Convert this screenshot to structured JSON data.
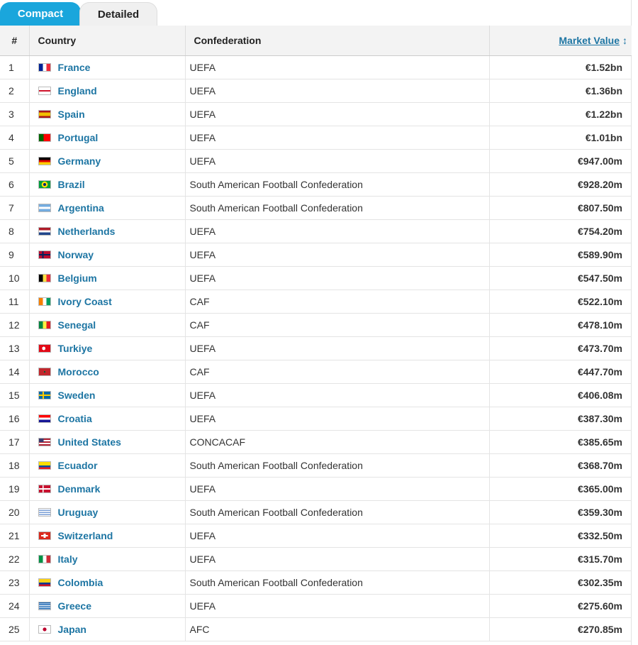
{
  "tabs": [
    {
      "label": "Compact",
      "active": true
    },
    {
      "label": "Detailed",
      "active": false
    }
  ],
  "table": {
    "headers": {
      "rank": "#",
      "country": "Country",
      "confederation": "Confederation",
      "value": "Market Value",
      "sort_icon": "↕"
    },
    "rows": [
      {
        "rank": "1",
        "country": "France",
        "confederation": "UEFA",
        "value": "€1.52bn",
        "flag": "france"
      },
      {
        "rank": "2",
        "country": "England",
        "confederation": "UEFA",
        "value": "€1.36bn",
        "flag": "england"
      },
      {
        "rank": "3",
        "country": "Spain",
        "confederation": "UEFA",
        "value": "€1.22bn",
        "flag": "spain"
      },
      {
        "rank": "4",
        "country": "Portugal",
        "confederation": "UEFA",
        "value": "€1.01bn",
        "flag": "portugal"
      },
      {
        "rank": "5",
        "country": "Germany",
        "confederation": "UEFA",
        "value": "€947.00m",
        "flag": "germany"
      },
      {
        "rank": "6",
        "country": "Brazil",
        "confederation": "South American Football Confederation",
        "value": "€928.20m",
        "flag": "brazil"
      },
      {
        "rank": "7",
        "country": "Argentina",
        "confederation": "South American Football Confederation",
        "value": "€807.50m",
        "flag": "argentina"
      },
      {
        "rank": "8",
        "country": "Netherlands",
        "confederation": "UEFA",
        "value": "€754.20m",
        "flag": "netherlands"
      },
      {
        "rank": "9",
        "country": "Norway",
        "confederation": "UEFA",
        "value": "€589.90m",
        "flag": "norway"
      },
      {
        "rank": "10",
        "country": "Belgium",
        "confederation": "UEFA",
        "value": "€547.50m",
        "flag": "belgium"
      },
      {
        "rank": "11",
        "country": "Ivory Coast",
        "confederation": "CAF",
        "value": "€522.10m",
        "flag": "ivory-coast"
      },
      {
        "rank": "12",
        "country": "Senegal",
        "confederation": "CAF",
        "value": "€478.10m",
        "flag": "senegal"
      },
      {
        "rank": "13",
        "country": "Turkiye",
        "confederation": "UEFA",
        "value": "€473.70m",
        "flag": "turkiye"
      },
      {
        "rank": "14",
        "country": "Morocco",
        "confederation": "CAF",
        "value": "€447.70m",
        "flag": "morocco"
      },
      {
        "rank": "15",
        "country": "Sweden",
        "confederation": "UEFA",
        "value": "€406.08m",
        "flag": "sweden"
      },
      {
        "rank": "16",
        "country": "Croatia",
        "confederation": "UEFA",
        "value": "€387.30m",
        "flag": "croatia"
      },
      {
        "rank": "17",
        "country": "United States",
        "confederation": "CONCACAF",
        "value": "€385.65m",
        "flag": "united-states"
      },
      {
        "rank": "18",
        "country": "Ecuador",
        "confederation": "South American Football Confederation",
        "value": "€368.70m",
        "flag": "ecuador"
      },
      {
        "rank": "19",
        "country": "Denmark",
        "confederation": "UEFA",
        "value": "€365.00m",
        "flag": "denmark"
      },
      {
        "rank": "20",
        "country": "Uruguay",
        "confederation": "South American Football Confederation",
        "value": "€359.30m",
        "flag": "uruguay"
      },
      {
        "rank": "21",
        "country": "Switzerland",
        "confederation": "UEFA",
        "value": "€332.50m",
        "flag": "switzerland"
      },
      {
        "rank": "22",
        "country": "Italy",
        "confederation": "UEFA",
        "value": "€315.70m",
        "flag": "italy"
      },
      {
        "rank": "23",
        "country": "Colombia",
        "confederation": "South American Football Confederation",
        "value": "€302.35m",
        "flag": "colombia"
      },
      {
        "rank": "24",
        "country": "Greece",
        "confederation": "UEFA",
        "value": "€275.60m",
        "flag": "greece"
      },
      {
        "rank": "25",
        "country": "Japan",
        "confederation": "AFC",
        "value": "€270.85m",
        "flag": "japan"
      }
    ]
  },
  "colors": {
    "accent": "#1aa6dc",
    "link": "#1d75a3",
    "header_bg": "#f3f3f3"
  }
}
